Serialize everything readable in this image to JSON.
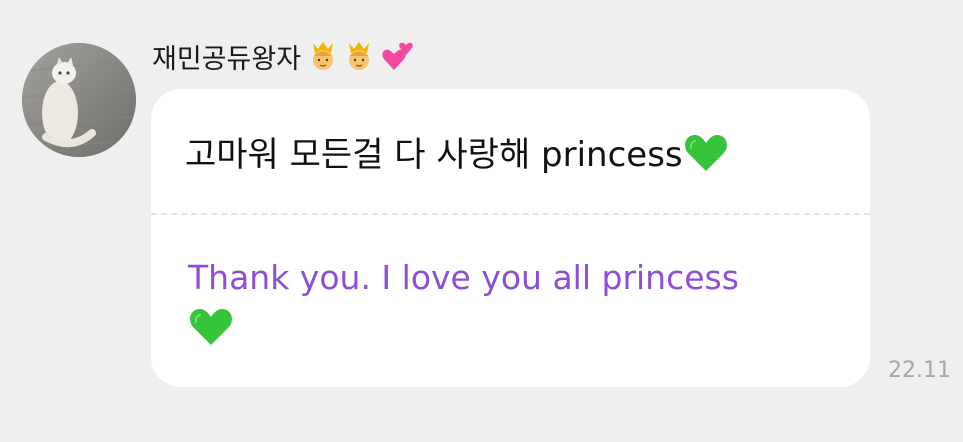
{
  "sender": {
    "name": "재민공듀왕자",
    "emojis": [
      "crown-prince-emoji",
      "crown-prince-emoji",
      "two-hearts-emoji"
    ]
  },
  "message": {
    "original_text": "고마워 모든걸 다 사랑해 princess",
    "original_emoji": "green-heart-emoji",
    "translation_text": "Thank you. I love you all princess",
    "translation_emoji": "green-heart-emoji",
    "timestamp": "22.11"
  },
  "colors": {
    "background": "#efeff0",
    "bubble": "#ffffff",
    "translation_text": "#8c4fd6",
    "timestamp": "#a7a7a7",
    "green_heart": "#35c43a"
  }
}
